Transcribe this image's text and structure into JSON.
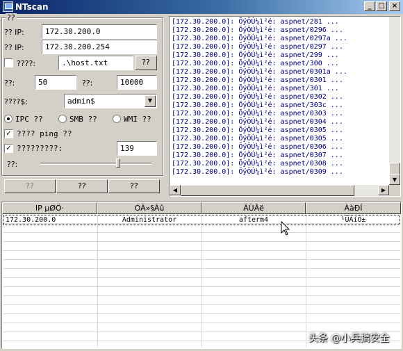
{
  "window": {
    "title": "NTscan",
    "minimize": "_",
    "maximize": "□",
    "close": "×"
  },
  "config": {
    "group_title": "??",
    "start_ip": {
      "label": "?? IP:",
      "value": "172.30.200.0"
    },
    "end_ip": {
      "label": "?? IP:",
      "value": "172.30.200.254"
    },
    "host_file": {
      "label": "????:",
      "value": ".\\host.txt",
      "browse": "??",
      "checked": false
    },
    "threads": {
      "label": "??:",
      "value": "50"
    },
    "timeout": {
      "label": "??:",
      "value": "10000"
    },
    "share": {
      "label": "????$:",
      "value": "admin$"
    },
    "protocols": [
      {
        "label": "IPC ??",
        "selected": true
      },
      {
        "label": "SMB ??",
        "selected": false
      },
      {
        "label": "WMI ??",
        "selected": false
      }
    ],
    "ping": {
      "label": "???? ping ??",
      "checked": true
    },
    "port": {
      "label": "?????????:",
      "checked": true,
      "value": "139"
    },
    "speed": {
      "label": "??:",
      "level": 0.68
    },
    "buttons": [
      "??",
      "??",
      "??"
    ]
  },
  "log": {
    "lines": [
      "[172.30.200.0]: ÕýÔÚ¼ì²é: aspnet/281 ...",
      "[172.30.200.0]: ÕýÔÚ¼ì²é: aspnet/0296 ...",
      "[172.30.200.0]: ÕýÔÚ¼ì²é: aspnet/0297a ...",
      "[172.30.200.0]: ÕýÔÚ¼ì²é: aspnet/0297 ...",
      "[172.30.200.0]: ÕýÔÚ¼ì²é: aspnet/299 ...",
      "[172.30.200.0]: ÕýÔÚ¼ì²é: aspnet/300 ...",
      "[172.30.200.0]: ÕýÔÚ¼ì²é: aspnet/0301a ...",
      "[172.30.200.0]: ÕýÔÚ¼ì²é: aspnet/0301 ...",
      "[172.30.200.0]: ÕýÔÚ¼ì²é: aspnet/301 ...",
      "[172.30.200.0]: ÕýÔÚ¼ì²é: aspnet/0302 ...",
      "[172.30.200.0]: ÕýÔÚ¼ì²é: aspnet/303c ...",
      "[172.30.200.0]: ÕýÔÚ¼ì²é: aspnet/0303 ...",
      "[172.30.200.0]: ÕýÔÚ¼ì²é: aspnet/0304 ...",
      "[172.30.200.0]: ÕýÔÚ¼ì²é: aspnet/0305 ...",
      "[172.30.200.0]: ÕýÔÚ¼ì²é: aspnet/0305 ...",
      "[172.30.200.0]: ÕýÔÚ¼ì²é: aspnet/0306 ...",
      "[172.30.200.0]: ÕýÔÚ¼ì²é: aspnet/0307 ...",
      "[172.30.200.0]: ÕýÔÚ¼ì²é: aspnet/0308 ...",
      "[172.30.200.0]: ÕýÔÚ¼ì²é: aspnet/0309 ..."
    ]
  },
  "results": {
    "columns": [
      "IP µØÖ·",
      "ÓÃ»§Ãû",
      "ÃÜÂë",
      "ÀàÐÍ"
    ],
    "rows": [
      [
        "172.30.200.0",
        "Administrator",
        "afterm4",
        "¹ÜÀíÔ±"
      ]
    ]
  },
  "watermark": "头条 @小兵搞安全"
}
